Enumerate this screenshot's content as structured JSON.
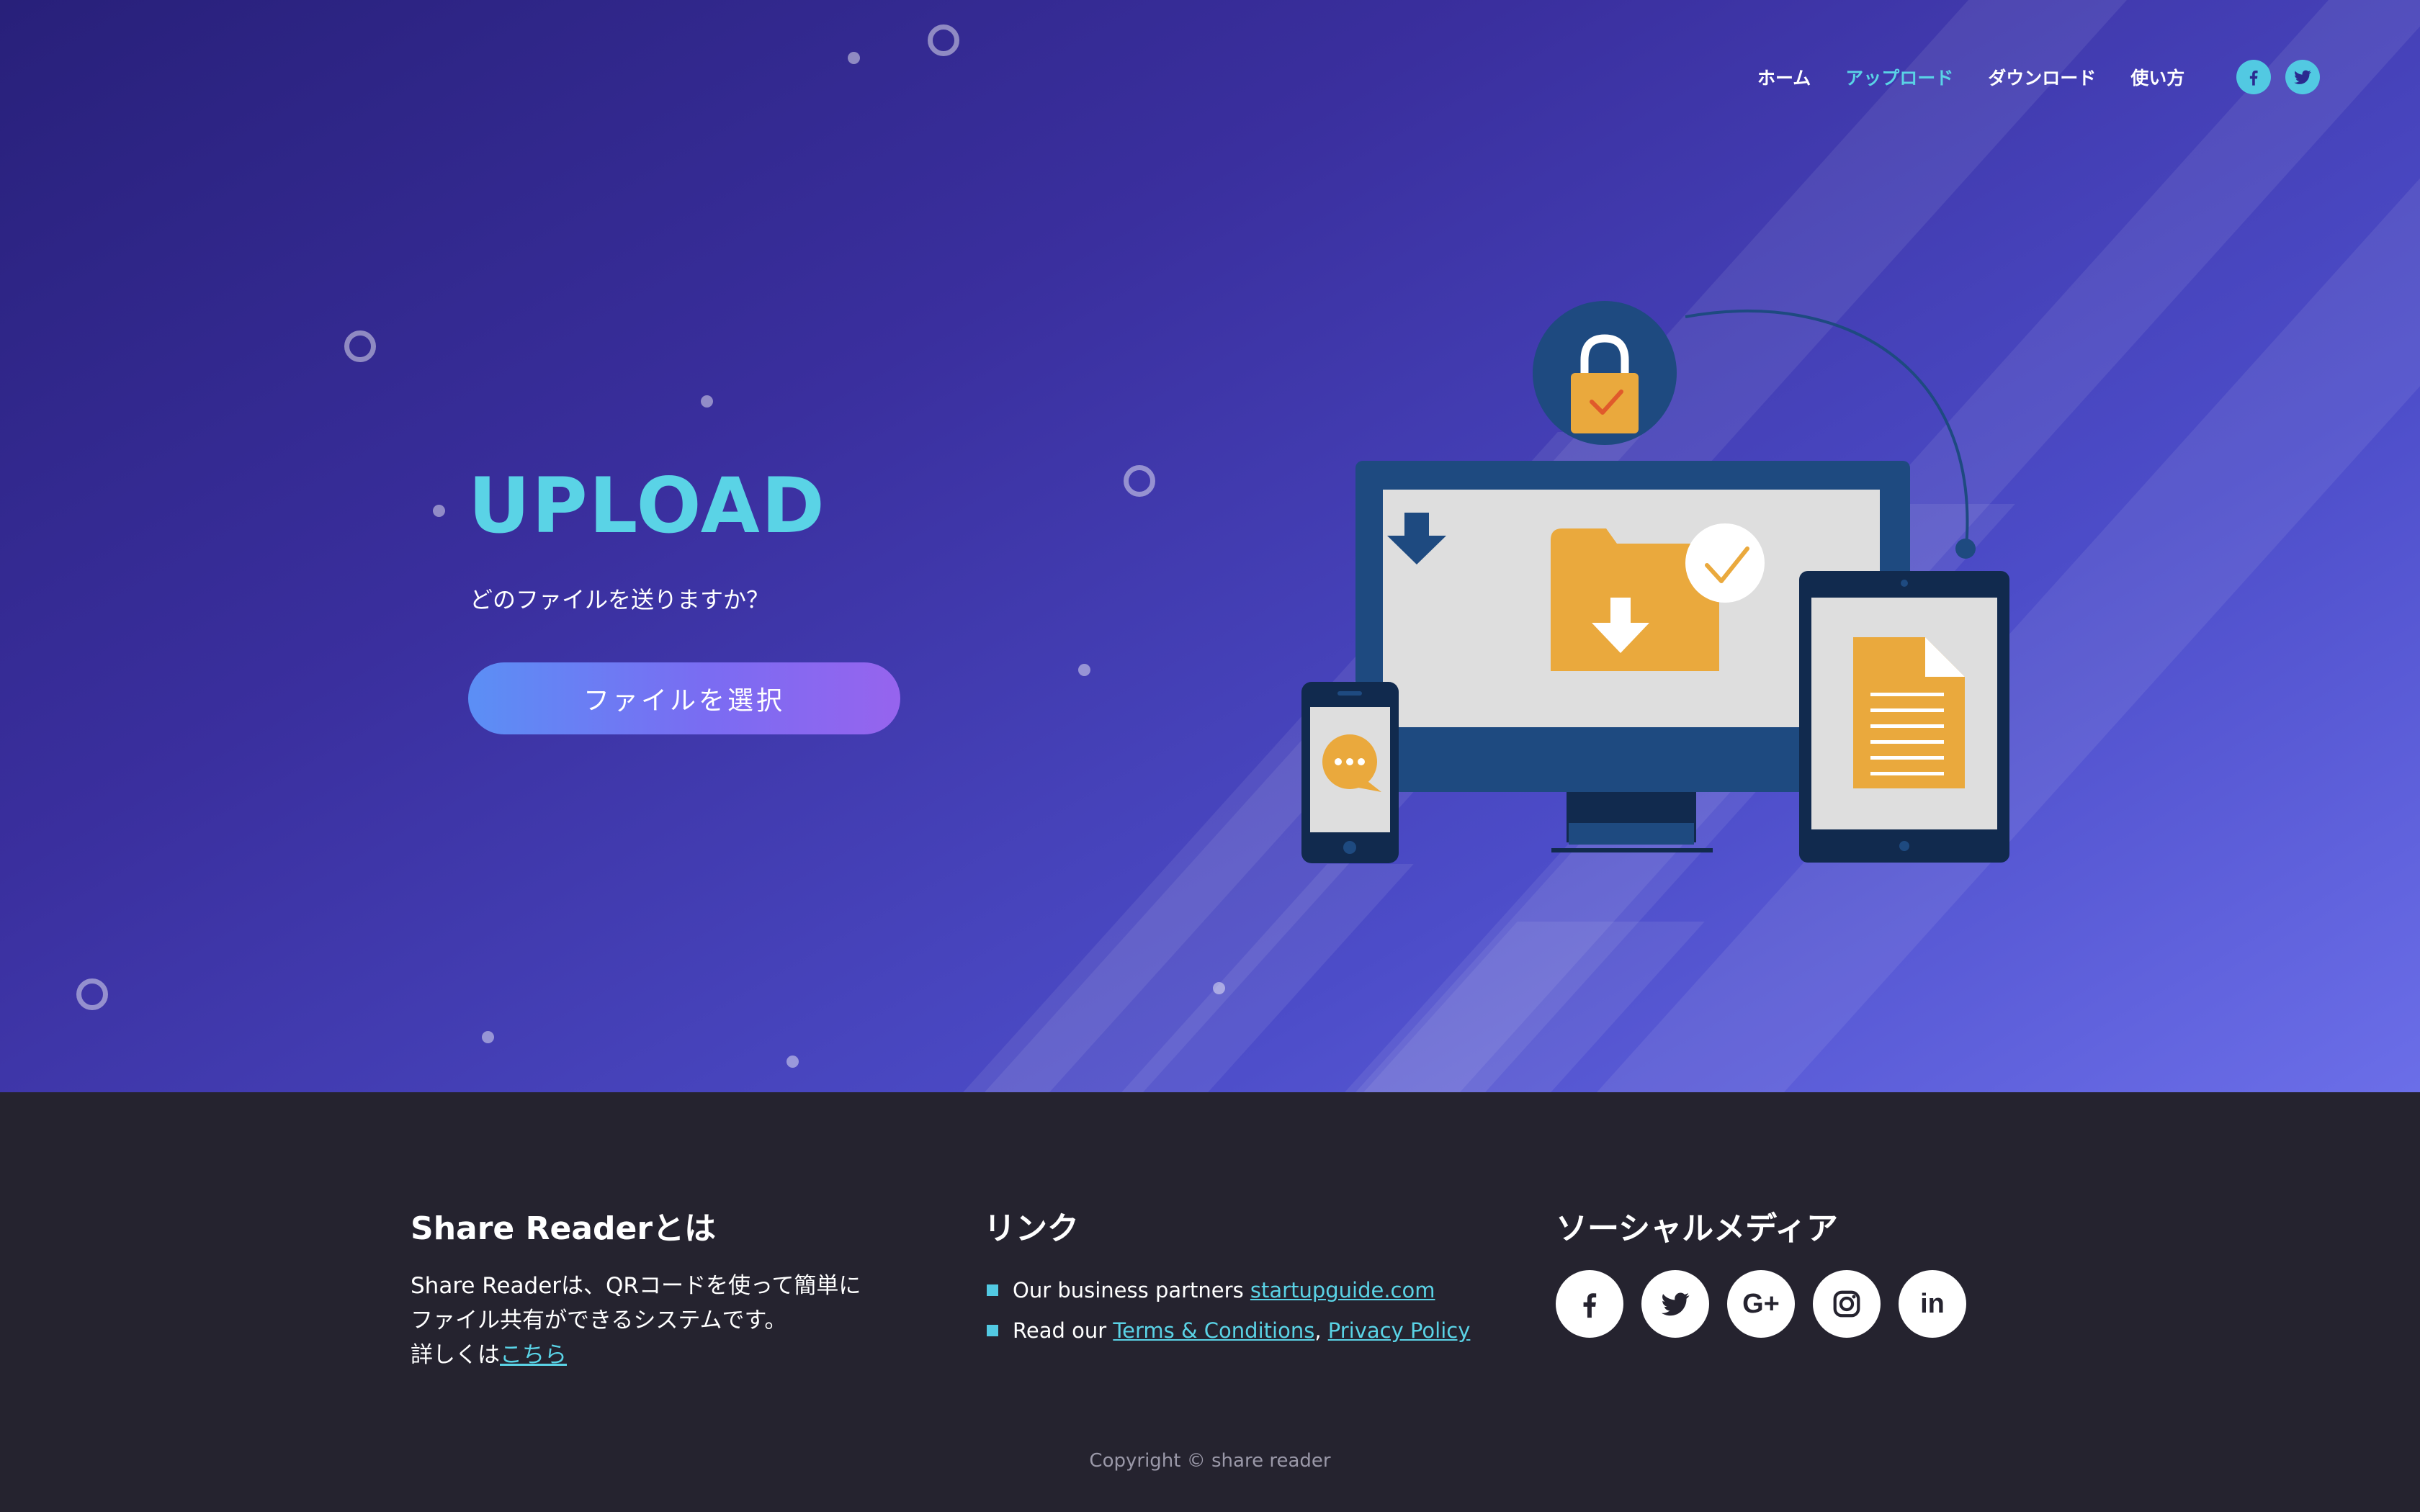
{
  "nav": {
    "items": [
      {
        "label": "ホーム",
        "active": false
      },
      {
        "label": "アップロード",
        "active": true
      },
      {
        "label": "ダウンロード",
        "active": false
      },
      {
        "label": "使い方",
        "active": false
      }
    ],
    "social_icons": [
      "facebook-icon",
      "twitter-icon"
    ]
  },
  "hero": {
    "title": "UPLOAD",
    "subtitle": "どのファイルを送りますか？",
    "button_label": "ファイルを選択"
  },
  "footer": {
    "about": {
      "heading": "Share Readerとは",
      "line1": "Share Readerは、QRコードを使って簡単に",
      "line2": "ファイル共有ができるシステムです。",
      "line3_prefix": "詳しくは",
      "line3_link": "こちら"
    },
    "links": {
      "heading": "リンク",
      "partners_prefix": "Our business partners ",
      "partners_link": "startupguide.com",
      "read_prefix": "Read our ",
      "terms_link": "Terms & Conditions",
      "separator": ", ",
      "privacy_link": "Privacy Policy"
    },
    "social": {
      "heading": "ソーシャルメディア",
      "icons": [
        "facebook-icon",
        "twitter-icon",
        "google-plus-icon",
        "instagram-icon",
        "linkedin-icon"
      ],
      "google_plus_text": "G+",
      "linkedin_text": "in"
    },
    "copyright": "Copyright © share reader"
  },
  "colors": {
    "accent": "#5ad3e6",
    "footer_bg": "#25232f",
    "button_gradient_start": "#5b8ff5",
    "button_gradient_end": "#9664ee",
    "hero_bg_dark": "#28207a",
    "hero_bg_light": "#6b6ee8"
  }
}
